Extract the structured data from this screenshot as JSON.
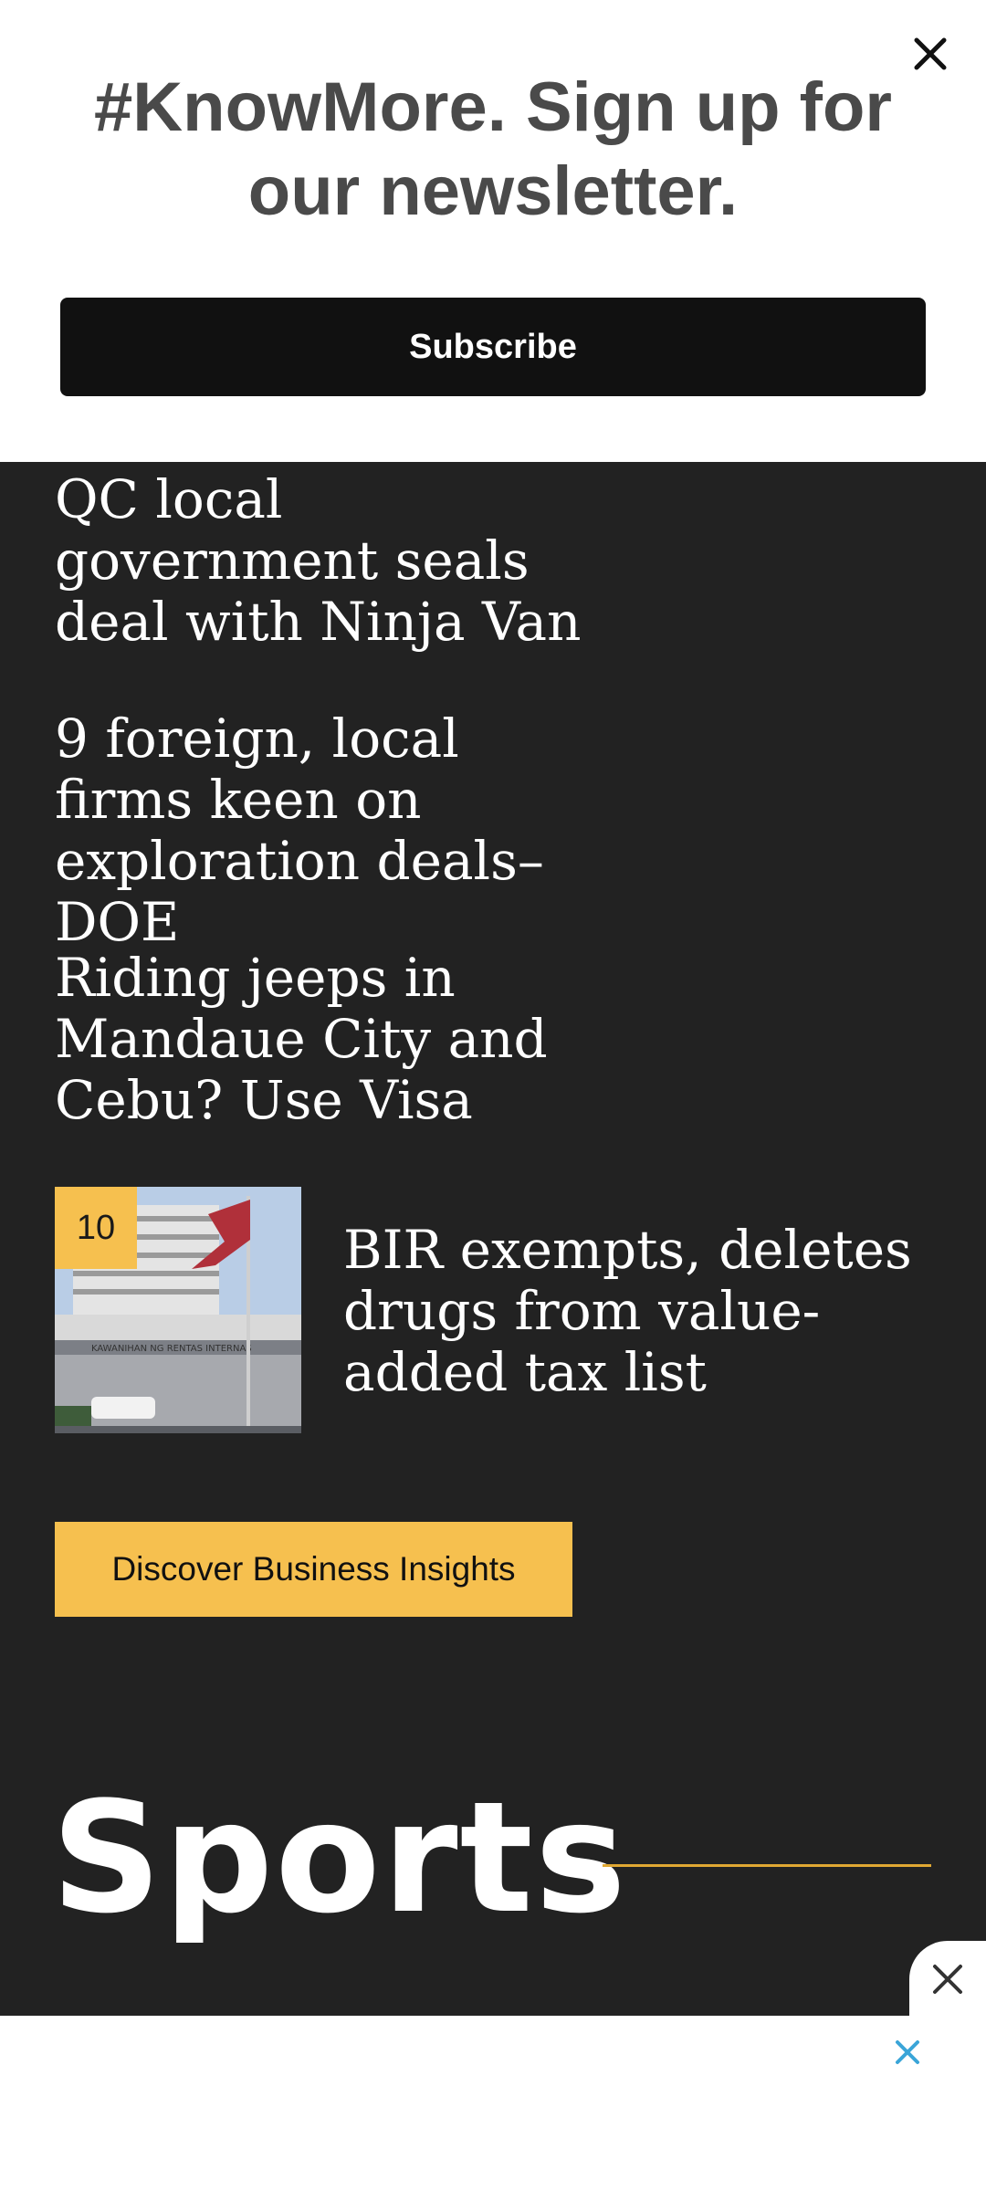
{
  "newsletter": {
    "title": "#KnowMore. Sign up for our newsletter.",
    "subscribe_label": "Subscribe",
    "close_icon": "close-icon"
  },
  "headlines": [
    {
      "title": "QC local government seals deal with Ninja Van"
    },
    {
      "title": "9 foreign, local firms keen on exploration deals–DOE"
    },
    {
      "title": "Riding jeeps in Mandaue City and Cebu? Use Visa"
    }
  ],
  "ranked_story": {
    "rank": "10",
    "title": "BIR exempts, deletes drugs from value-added tax list",
    "image_icon": "building-flag-photo"
  },
  "discover_label": "Discover Business Insights",
  "sports": {
    "title": "Sports"
  },
  "ad": {
    "close_icon": "close-icon",
    "ad_icon": "ad-choices-x-icon"
  },
  "colors": {
    "background": "#222222",
    "accent_yellow": "#f6c04f",
    "rule_gold": "#e0a833",
    "ad_x_blue": "#3aa5d8"
  }
}
